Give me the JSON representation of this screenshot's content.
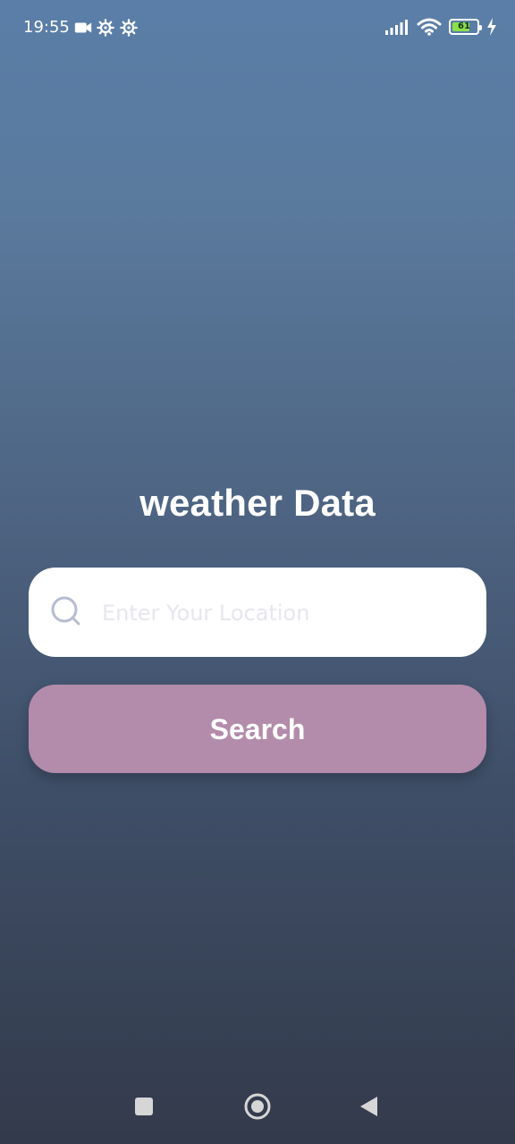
{
  "status_bar": {
    "time": "19:55",
    "battery_level": "61",
    "icons": {
      "video": "video-camera-icon",
      "settings_1": "gear-icon",
      "settings_2": "gear-icon",
      "signal": "signal-bars-icon",
      "wifi": "wifi-icon",
      "battery": "battery-icon",
      "charging": "lightning-bolt-icon"
    }
  },
  "main": {
    "title": "weather Data",
    "search": {
      "placeholder": "Enter Your Location",
      "value": "",
      "icon": "search-icon"
    },
    "button_label": "Search"
  },
  "navigation_bar": {
    "recent_icon": "square-icon",
    "home_icon": "circle-home-icon",
    "back_icon": "triangle-back-icon"
  },
  "colors": {
    "background_top": "#5a7ea8",
    "background_bottom": "#333a4b",
    "search_button": "#b38bab",
    "search_box": "#ffffff",
    "battery_fill": "#8be04a",
    "search_icon": "#b8bcd2"
  }
}
